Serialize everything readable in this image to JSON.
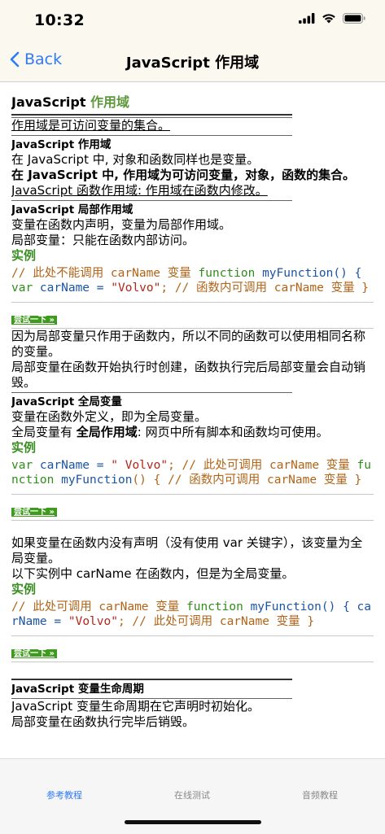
{
  "status": {
    "time": "10:32",
    "icons": [
      "signal-icon",
      "wifi-icon",
      "battery-icon"
    ]
  },
  "nav": {
    "back_label": "Back",
    "title": "JavaScript 作用域"
  },
  "article": {
    "h1_a": "JavaScript",
    "h1_b": "作用域",
    "intro": "作用域是可访问变量的集合。",
    "s1_title": "JavaScript 作用域",
    "s1_p1": "在 JavaScript 中, 对象和函数同样也是变量。",
    "s1_p2": "在 JavaScript 中, 作用域为可访问变量，对象，函数的集合。",
    "s1_p3": "JavaScript 函数作用域: 作用域在函数内修改。",
    "s2_title": "JavaScript 局部作用域",
    "s2_p1": "变量在函数内声明，变量为局部作用域。",
    "s2_p2": "局部变量：只能在函数内部访问。",
    "example_label": "实例",
    "code1": {
      "a": "// 此处不能调用 carName 变量 ",
      "b": "function",
      "c": " myFunction",
      "d": "() { ",
      "e": "var",
      "f": " carName",
      "g": " = ",
      "h": "\"Volvo\"",
      "i": "; // 函数内可调用 carName 变量 }"
    },
    "try_label": "尝试一下 »",
    "s2_p3": "因为局部变量只作用于函数内，所以不同的函数可以使用相同名称的变量。",
    "s2_p4": "局部变量在函数开始执行时创建，函数执行完后局部变量会自动销毁。",
    "s3_title": "JavaScript 全局变量",
    "s3_p1": "变量在函数外定义，即为全局变量。",
    "s3_p2a": "全局变量有 ",
    "s3_p2b": "全局作用域",
    "s3_p2c": ": 网页中所有脚本和函数均可使用。",
    "code2": {
      "a": "var",
      "b": " carName",
      "c": " = ",
      "d": "\" Volvo\"",
      "e": "; // 此处可调用 carName 变量 ",
      "f": "function",
      "g": " myFunction",
      "h": "() { // 函数内可调用 carName 变量 }"
    },
    "s4_p1": "如果变量在函数内没有声明（没有使用 var 关键字），该变量为全局变量。",
    "s4_p2": "以下实例中 carName 在函数内，但是为全局变量。",
    "code3": {
      "a": "// 此处可调用 carName 变量 ",
      "b": "function",
      "c": " myFunction",
      "d": "() { ",
      "e": "carName",
      "f": " = ",
      "g": "\"Volvo\"",
      "h": "; // 此处可调用 carName 变量 }"
    },
    "s5_title": "JavaScript 变量生命周期",
    "s5_p1": "JavaScript 变量生命周期在它声明时初始化。",
    "s5_p2": "局部变量在函数执行完毕后销毁。"
  },
  "tabs": [
    {
      "label": "参考教程",
      "active": true
    },
    {
      "label": "在线测试",
      "active": false
    },
    {
      "label": "音频教程",
      "active": false
    }
  ],
  "colors": {
    "accent": "#2f7bf6",
    "green": "#3a8f23",
    "code_keyword": "#2f8d1a",
    "code_comment": "#b06418",
    "code_string": "#b0271a"
  }
}
